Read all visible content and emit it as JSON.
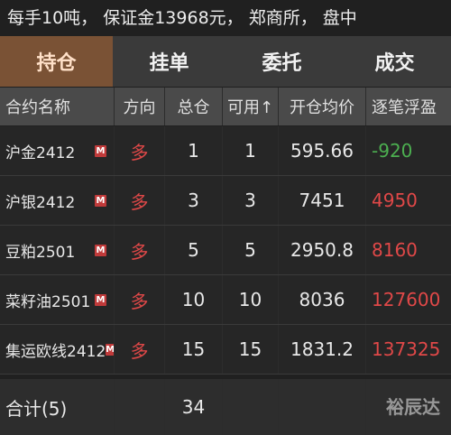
{
  "info_bar": "每手10吨， 保证金13968元， 郑商所， 盘中",
  "tabs": [
    "持仓",
    "挂单",
    "委托",
    "成交"
  ],
  "headers": [
    "合约名称",
    "方向",
    "总仓",
    "可用↑",
    "开仓均价",
    "逐笔浮盈"
  ],
  "rows": [
    {
      "name": "沪金2412",
      "badge": "M",
      "dir": "多",
      "total": "1",
      "avail": "1",
      "price": "595.66",
      "pnl": "-920"
    },
    {
      "name": "沪银2412",
      "badge": "M",
      "dir": "多",
      "total": "3",
      "avail": "3",
      "price": "7451",
      "pnl": "4950"
    },
    {
      "name": "豆粕2501",
      "badge": "M",
      "dir": "多",
      "total": "5",
      "avail": "5",
      "price": "2950.8",
      "pnl": "8160"
    },
    {
      "name": "菜籽油2501",
      "badge": "M",
      "dir": "多",
      "total": "10",
      "avail": "10",
      "price": "8036",
      "pnl": "127600"
    },
    {
      "name": "集运欧线2412",
      "badge": "M",
      "dir": "多",
      "total": "15",
      "avail": "15",
      "price": "1831.2",
      "pnl": "137325"
    }
  ],
  "footer": {
    "label": "合计(5)",
    "total": "34"
  },
  "watermark": "裕辰达",
  "colors": {
    "active_tab": "#7a5235",
    "loss": "#4caf50",
    "profit": "#e04848",
    "badge": "#c03a3a"
  }
}
